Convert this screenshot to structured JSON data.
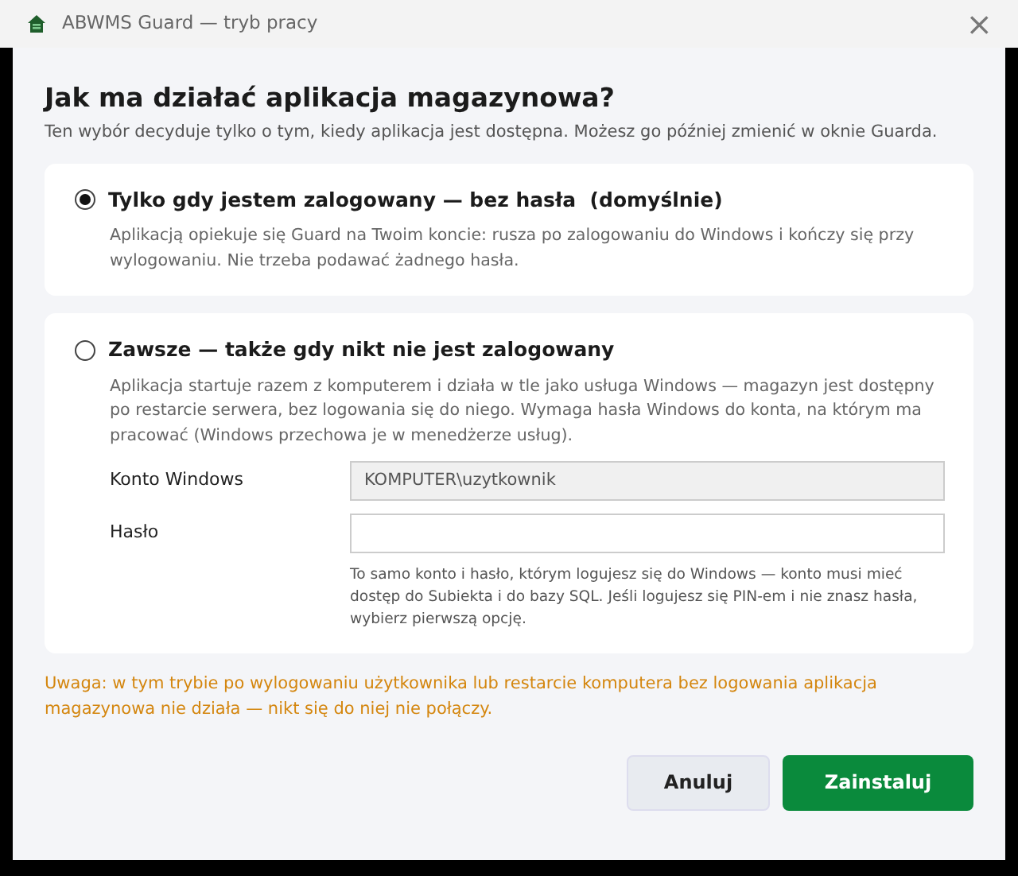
{
  "window": {
    "title": "ABWMS Guard — tryb pracy",
    "close": "×"
  },
  "heading": "Jak ma działać aplikacja magazynowa?",
  "subtitle": "Ten wybór decyduje tylko o tym, kiedy aplikacja jest dostępna. Możesz go później zmienić w oknie Guarda.",
  "options": [
    {
      "label": "Tylko gdy jestem zalogowany — bez hasła  (domyślnie)",
      "selected": true,
      "description": "Aplikacją opiekuje się Guard na Twoim koncie: rusza po zalogowaniu do Windows i kończy się przy wylogowaniu. Nie trzeba podawać żadnego hasła."
    },
    {
      "label": "Zawsze — także gdy nikt nie jest zalogowany",
      "selected": false,
      "description": "Aplikacja startuje razem z komputerem i działa w tle jako usługa Windows — magazyn jest dostępny po restarcie serwera, bez logowania się do niego. Wymaga hasła Windows do konta, na którym ma pracować (Windows przechowa je w menedżerze usług).",
      "fields": [
        {
          "label": "Konto Windows",
          "value": "KOMPUTER\\uzytkownik",
          "disabled": true
        },
        {
          "label": "Hasło",
          "disabled": false
        }
      ],
      "hint": "To samo konto i hasło, którym logujesz się do Windows — konto musi mieć dostęp do Subiekta i do bazy SQL. Jeśli logujesz się PIN-em i nie znasz hasła, wybierz pierwszą opcję."
    }
  ],
  "warning": "Uwaga: w tym trybie po wylogowaniu użytkownika lub restarcie komputera bez logowania aplikacja magazynowa nie działa — nikt się do niej nie połączy.",
  "buttons": [
    {
      "label": "Anuluj",
      "kind": "secondary"
    },
    {
      "label": "Zainstaluj",
      "kind": "primary"
    }
  ]
}
